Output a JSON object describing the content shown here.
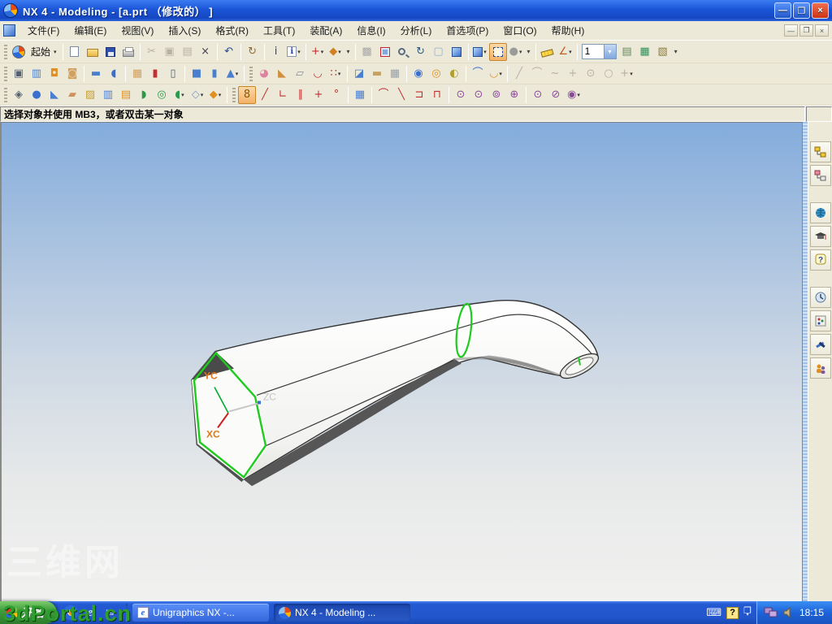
{
  "window": {
    "title": "NX 4 - Modeling - [a.prt （修改的） ]",
    "controls": {
      "minimize": "—",
      "restore": "❐",
      "close": "×"
    },
    "mdi_controls": {
      "minimize": "—",
      "restore": "❐",
      "close": "×"
    }
  },
  "icons": {
    "caret": "▾",
    "keyboard": "⌨",
    "ime": "?",
    "stack": "❐",
    "ie": "e",
    "wmp": "◉",
    "mail": "✉"
  },
  "menu": {
    "items": [
      {
        "name": "menu-file",
        "label": "文件(F)"
      },
      {
        "name": "menu-edit",
        "label": "编辑(E)"
      },
      {
        "name": "menu-view",
        "label": "视图(V)"
      },
      {
        "name": "menu-insert",
        "label": "插入(S)"
      },
      {
        "name": "menu-format",
        "label": "格式(R)"
      },
      {
        "name": "menu-tools",
        "label": "工具(T)"
      },
      {
        "name": "menu-assemblies",
        "label": "装配(A)"
      },
      {
        "name": "menu-information",
        "label": "信息(I)"
      },
      {
        "name": "menu-analysis",
        "label": "分析(L)"
      },
      {
        "name": "menu-preferences",
        "label": "首选项(P)"
      },
      {
        "name": "menu-window",
        "label": "窗口(O)"
      },
      {
        "name": "menu-help",
        "label": "帮助(H)"
      }
    ]
  },
  "toolbars": {
    "rows": [
      [
        {
          "t": "g"
        },
        {
          "t": "b",
          "n": "start-logo",
          "cls": "nx"
        },
        {
          "t": "L",
          "n": "start-menu",
          "text": "起始",
          "dd": 1
        },
        {
          "t": "s"
        },
        {
          "t": "b",
          "n": "new-file",
          "cls": "doc"
        },
        {
          "t": "b",
          "n": "open-file",
          "cls": "folder"
        },
        {
          "t": "b",
          "n": "save-file",
          "cls": "disk"
        },
        {
          "t": "b",
          "n": "print",
          "cls": "printer"
        },
        {
          "t": "s"
        },
        {
          "t": "b",
          "n": "cut",
          "g": "✂",
          "d": 1
        },
        {
          "t": "b",
          "n": "copy",
          "g": "▣",
          "d": 1
        },
        {
          "t": "b",
          "n": "paste",
          "g": "▤",
          "d": 1
        },
        {
          "t": "b",
          "n": "delete",
          "g": "×",
          "c": "#445"
        },
        {
          "t": "s"
        },
        {
          "t": "b",
          "n": "undo",
          "g": "↶",
          "c": "#234a9a"
        },
        {
          "t": "s"
        },
        {
          "t": "b",
          "n": "repeat-command",
          "g": "↻",
          "c": "#9a6a2a"
        },
        {
          "t": "s"
        },
        {
          "t": "b",
          "n": "object-information",
          "g": "i",
          "c": "#1a3fbf"
        },
        {
          "t": "b",
          "n": "information-window",
          "cls": "infoi",
          "dd": 1
        },
        {
          "t": "s"
        },
        {
          "t": "b",
          "n": "selection-filter",
          "g": "+",
          "c": "#c03030",
          "dd": 1
        },
        {
          "t": "b",
          "n": "type-filter",
          "g": "◆",
          "c": "#d08020",
          "dd": 1
        },
        {
          "t": "v",
          "n": "standard-toolbar-options"
        },
        {
          "t": "s"
        },
        {
          "t": "b",
          "n": "refresh-display",
          "g": "▩",
          "c": "#a8a8a8"
        },
        {
          "t": "b",
          "n": "fit-view",
          "cls": "fit"
        },
        {
          "t": "b",
          "n": "zoom-view",
          "cls": "mag"
        },
        {
          "t": "b",
          "n": "rotate-view",
          "g": "↻",
          "c": "#355a7a"
        },
        {
          "t": "b",
          "n": "restore-orientation",
          "g": "▢",
          "c": "#9ab0c8"
        },
        {
          "t": "b",
          "n": "snapshot-view",
          "cls": "cube"
        },
        {
          "t": "s"
        },
        {
          "t": "b",
          "n": "shaded-display",
          "cls": "cube",
          "dd": 1
        },
        {
          "t": "b",
          "n": "wireframe-display",
          "cls": "cubewire",
          "h": 1
        },
        {
          "t": "b",
          "n": "hidden-edge-display",
          "g": "●",
          "c": "#9a9a9a",
          "dd": 1
        },
        {
          "t": "v",
          "n": "view-toolbar-options"
        },
        {
          "t": "s"
        },
        {
          "t": "b",
          "n": "measure-distance",
          "cls": "ruler"
        },
        {
          "t": "b",
          "n": "measure-angle",
          "g": "∠",
          "c": "#c06020",
          "dd": 1
        },
        {
          "t": "s"
        },
        {
          "t": "C",
          "n": "work-layer-combo",
          "value": "1"
        },
        {
          "t": "b",
          "n": "layer-settings",
          "g": "▤",
          "c": "#6a8a5a"
        },
        {
          "t": "b",
          "n": "layer-visible-in-view",
          "g": "▦",
          "c": "#3a8a5a"
        },
        {
          "t": "b",
          "n": "layer-category",
          "g": "▧",
          "c": "#8a7a3a"
        },
        {
          "t": "v",
          "n": "utility-toolbar-options"
        }
      ],
      [
        {
          "t": "g"
        },
        {
          "t": "b",
          "n": "sketch",
          "g": "▣",
          "c": "#556070"
        },
        {
          "t": "b",
          "n": "datum-plane",
          "g": "▥",
          "c": "#4a7fd0"
        },
        {
          "t": "b",
          "n": "hole",
          "g": "◘",
          "c": "#e09020"
        },
        {
          "t": "b",
          "n": "boss",
          "g": "◙",
          "c": "#d0a060"
        },
        {
          "t": "s"
        },
        {
          "t": "b",
          "n": "pad",
          "g": "▬",
          "c": "#4a7fd0"
        },
        {
          "t": "b",
          "n": "pocket",
          "g": "◖",
          "c": "#3a6fd0"
        },
        {
          "t": "s"
        },
        {
          "t": "b",
          "n": "emboss",
          "g": "▦",
          "c": "#d0a060"
        },
        {
          "t": "b",
          "n": "slot",
          "g": "▮",
          "c": "#c03030"
        },
        {
          "t": "b",
          "n": "groove",
          "g": "▯",
          "c": "#556070"
        },
        {
          "t": "s"
        },
        {
          "t": "b",
          "n": "block",
          "g": "■",
          "c": "#4a7fd0"
        },
        {
          "t": "b",
          "n": "cylinder",
          "g": "▮",
          "c": "#4a7fd0"
        },
        {
          "t": "b",
          "n": "cone",
          "g": "▲",
          "c": "#4a7fd0",
          "dd": 1
        },
        {
          "t": "s"
        },
        {
          "t": "g"
        },
        {
          "t": "b",
          "n": "edge-blend",
          "g": "◕",
          "c": "#e080a0"
        },
        {
          "t": "b",
          "n": "chamfer",
          "g": "◣",
          "c": "#d09040"
        },
        {
          "t": "b",
          "n": "draft",
          "g": "▱",
          "c": "#88909a"
        },
        {
          "t": "b",
          "n": "shell",
          "g": "◡",
          "c": "#c03030"
        },
        {
          "t": "b",
          "n": "instance-feature",
          "g": "∷",
          "c": "#c03030",
          "dd": 1
        },
        {
          "t": "s"
        },
        {
          "t": "b",
          "n": "trim-body",
          "g": "◪",
          "c": "#4a7fd0"
        },
        {
          "t": "b",
          "n": "thicken",
          "g": "▬",
          "c": "#c8a060"
        },
        {
          "t": "b",
          "n": "sew",
          "g": "▦",
          "c": "#98a0a8"
        },
        {
          "t": "s"
        },
        {
          "t": "b",
          "n": "unite",
          "g": "◉",
          "c": "#3a6fd0"
        },
        {
          "t": "b",
          "n": "subtract",
          "g": "◎",
          "c": "#e09020"
        },
        {
          "t": "b",
          "n": "intersect",
          "g": "◐",
          "c": "#b0a030"
        },
        {
          "t": "s"
        },
        {
          "t": "b",
          "n": "sweep-along-guide",
          "g": "⌒",
          "c": "#3a6fd0"
        },
        {
          "t": "b",
          "n": "tube",
          "g": "◡",
          "c": "#e09020",
          "dd": 1
        },
        {
          "t": "s"
        },
        {
          "t": "b",
          "n": "basic-line",
          "g": "╱",
          "d": 1
        },
        {
          "t": "b",
          "n": "basic-arc",
          "g": "⌒",
          "d": 1
        },
        {
          "t": "b",
          "n": "spline",
          "g": "~",
          "d": 1
        },
        {
          "t": "b",
          "n": "point",
          "g": "+",
          "d": 1
        },
        {
          "t": "b",
          "n": "basic-circle",
          "g": "⊙",
          "d": 1
        },
        {
          "t": "b",
          "n": "ellipse",
          "g": "○",
          "d": 1
        },
        {
          "t": "b",
          "n": "more-curves",
          "g": "+",
          "d": 1,
          "dd": 1
        }
      ],
      [
        {
          "t": "g"
        },
        {
          "t": "b",
          "n": "datum-csys",
          "g": "◈",
          "c": "#556070"
        },
        {
          "t": "b",
          "n": "sphere",
          "g": "●",
          "c": "#3a6fd0"
        },
        {
          "t": "b",
          "n": "swept",
          "g": "◣",
          "c": "#4a7fd0"
        },
        {
          "t": "b",
          "n": "section-surface",
          "g": "▰",
          "c": "#d09060"
        },
        {
          "t": "b",
          "n": "curve-mesh",
          "g": "▨",
          "c": "#c8a030"
        },
        {
          "t": "b",
          "n": "through-curves",
          "g": "▥",
          "c": "#4a7fd0"
        },
        {
          "t": "b",
          "n": "ruled-surface",
          "g": "▤",
          "c": "#e09020"
        },
        {
          "t": "b",
          "n": "styled-sweep",
          "g": "◗",
          "c": "#2a9a4a"
        },
        {
          "t": "b",
          "n": "tube-surface",
          "g": "◎",
          "c": "#2a9a4a"
        },
        {
          "t": "b",
          "n": "n-sided-surface",
          "g": "◖",
          "c": "#2a9a4a",
          "dd": 1
        },
        {
          "t": "b",
          "n": "trimmed-sheet",
          "g": "◇",
          "c": "#7a9ac8",
          "dd": 1
        },
        {
          "t": "b",
          "n": "offset-surface",
          "g": "◆",
          "c": "#e09020",
          "dd": 1
        },
        {
          "t": "s"
        },
        {
          "t": "g"
        },
        {
          "t": "b",
          "n": "snap-point-toggle",
          "g": "8",
          "c": "#8a5a10",
          "h": 1
        },
        {
          "t": "b",
          "n": "end-point",
          "g": "╱",
          "c": "#c03030"
        },
        {
          "t": "b",
          "n": "control-point",
          "g": "∟",
          "c": "#c03030"
        },
        {
          "t": "b",
          "n": "mid-point",
          "g": "∥",
          "c": "#c03030"
        },
        {
          "t": "b",
          "n": "intersection-point",
          "g": "+",
          "c": "#c03030"
        },
        {
          "t": "b",
          "n": "quadrant-point",
          "g": "°",
          "c": "#c03030"
        },
        {
          "t": "s"
        },
        {
          "t": "b",
          "n": "existing-point",
          "g": "▦",
          "c": "#4a7fd0"
        },
        {
          "t": "s"
        },
        {
          "t": "b",
          "n": "point-on-curve",
          "g": "⌒",
          "c": "#c03030"
        },
        {
          "t": "b",
          "n": "tangent-point",
          "g": "╲",
          "c": "#c03030"
        },
        {
          "t": "b",
          "n": "corner-point",
          "g": "⊐",
          "c": "#c03030"
        },
        {
          "t": "b",
          "n": "corner-point-2",
          "g": "⊓",
          "c": "#c03030"
        },
        {
          "t": "s"
        },
        {
          "t": "b",
          "n": "arc-center",
          "g": "⊙",
          "c": "#8a4a9a"
        },
        {
          "t": "b",
          "n": "arc-center-2",
          "g": "⊙",
          "c": "#8a4a9a"
        },
        {
          "t": "b",
          "n": "arc-center-3",
          "g": "⊚",
          "c": "#8a4a9a"
        },
        {
          "t": "b",
          "n": "arc-center-4",
          "g": "⊕",
          "c": "#8a4a9a"
        },
        {
          "t": "s"
        },
        {
          "t": "b",
          "n": "center-point",
          "g": "⊙",
          "c": "#8a4a9a"
        },
        {
          "t": "b",
          "n": "center-point-2",
          "g": "⊘",
          "c": "#8a4a9a"
        },
        {
          "t": "b",
          "n": "center-point-3",
          "g": "◉",
          "c": "#8a4a9a",
          "dd": 1
        }
      ]
    ]
  },
  "prompt": {
    "text": "选择对象并使用 MB3，或者双击某一对象"
  },
  "viewport": {
    "wcs": {
      "xc_label": "XC",
      "yc_label": "YC",
      "zc_label": "ZC"
    },
    "colors": {
      "face_edge_green": "#1ecb1e",
      "wcs_label_orange": "#e07818",
      "background_top": "#84acdc",
      "background_bottom": "#f1f1ef"
    }
  },
  "resource_bar": {
    "items": [
      "assembly-navigator",
      "part-navigator",
      "web-browser",
      "training",
      "help",
      "history",
      "palettes",
      "customize",
      "roles"
    ]
  },
  "watermark": {
    "line1": "三维网",
    "line2": "3dPortal.cn"
  },
  "taskbar": {
    "start_label": "开始",
    "tasks": [
      {
        "name": "task-unigraphics",
        "label": "Unigraphics NX -...",
        "active": false
      },
      {
        "name": "task-nx4",
        "label": "NX 4 - Modeling ...",
        "active": true
      }
    ],
    "clock": "18:15"
  }
}
